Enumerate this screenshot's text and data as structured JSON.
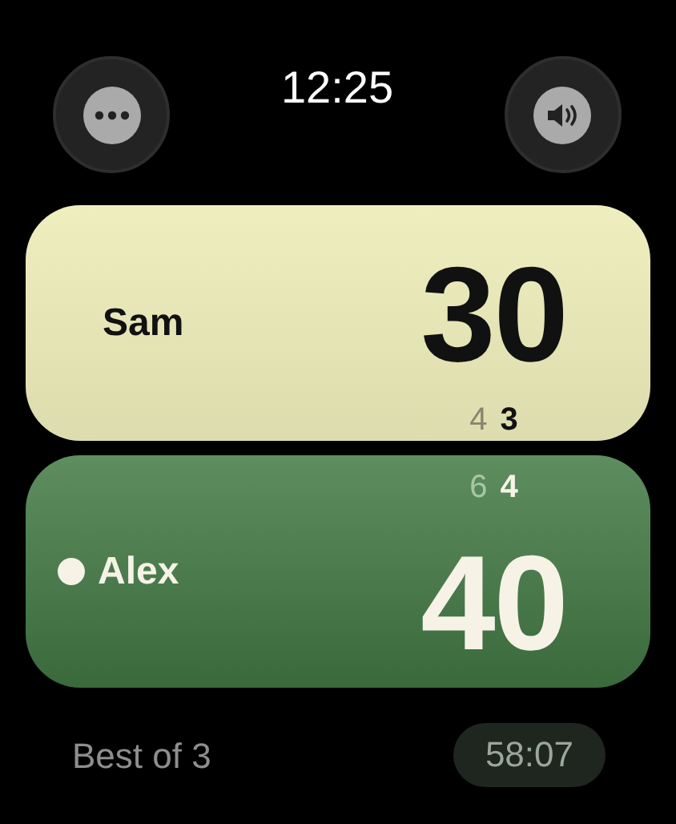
{
  "time": "12:25",
  "players": [
    {
      "name": "Sam",
      "kind": "light",
      "serving": false,
      "score": "30",
      "sets": [
        {
          "value": "4",
          "current": false
        },
        {
          "value": "3",
          "current": true
        }
      ]
    },
    {
      "name": "Alex",
      "kind": "dark",
      "serving": true,
      "score": "40",
      "sets": [
        {
          "value": "6",
          "current": false
        },
        {
          "value": "4",
          "current": true
        }
      ]
    }
  ],
  "format": "Best of 3",
  "elapsed": "58:07"
}
